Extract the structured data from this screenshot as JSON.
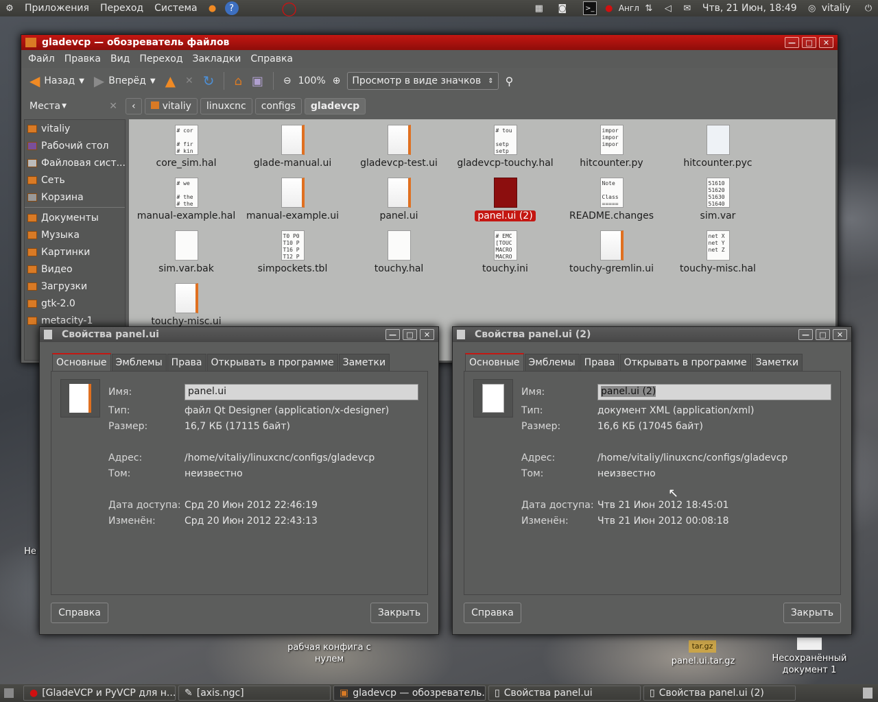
{
  "top_panel": {
    "menus": [
      "Приложения",
      "Переход",
      "Система"
    ],
    "keyboard_layout": "Англ",
    "clock": "Чтв, 21 Июн, 18:49",
    "user": "vitaliy"
  },
  "desktop": {
    "icons": [
      {
        "label": "рабчая конфига с нулем"
      },
      {
        "label": "panel.ui.tar.gz",
        "badge": "tar.gz"
      },
      {
        "label": "Несохранённый документ 1"
      },
      {
        "label": "Не"
      }
    ]
  },
  "file_browser": {
    "title": "gladevcp — обозреватель файлов",
    "menu": [
      "Файл",
      "Правка",
      "Вид",
      "Переход",
      "Закладки",
      "Справка"
    ],
    "toolbar": {
      "back": "Назад",
      "forward": "Вперёд",
      "zoom": "100%",
      "view_mode": "Просмотр в виде значков"
    },
    "places_label": "Места",
    "breadcrumbs": [
      "vitaliy",
      "linuxcnc",
      "configs",
      "gladevcp"
    ],
    "sidebar": [
      "vitaliy",
      "Рабочий стол",
      "Файловая сист...",
      "Сеть",
      "Корзина",
      "Документы",
      "Музыка",
      "Картинки",
      "Видео",
      "Загрузки",
      "gtk-2.0",
      "metacity-1"
    ],
    "files": [
      {
        "name": "core_sim.hal",
        "kind": "text",
        "preview": "# cor\n\n# fir\n# kin"
      },
      {
        "name": "glade-manual.ui",
        "kind": "ui",
        "preview": ""
      },
      {
        "name": "gladevcp-test.ui",
        "kind": "ui",
        "preview": ""
      },
      {
        "name": "gladevcp-touchy.hal",
        "kind": "text",
        "preview": "# tou\n\nsetp\nsetp"
      },
      {
        "name": "hitcounter.py",
        "kind": "text",
        "preview": "impor\nimpor\nimpor"
      },
      {
        "name": "hitcounter.pyc",
        "kind": "py",
        "preview": ""
      },
      {
        "name": "manual-example.hal",
        "kind": "text",
        "preview": "# we\n\n# the\n# the"
      },
      {
        "name": "manual-example.ui",
        "kind": "ui",
        "preview": ""
      },
      {
        "name": "panel.ui",
        "kind": "ui",
        "preview": ""
      },
      {
        "name": "panel.ui (2)",
        "kind": "selected",
        "preview": ""
      },
      {
        "name": "README.changes",
        "kind": "text",
        "preview": "Note\n\nClass\n====="
      },
      {
        "name": "sim.var",
        "kind": "text",
        "preview": "51610\n51620\n51630\n51640"
      },
      {
        "name": "sim.var.bak",
        "kind": "blank",
        "preview": ""
      },
      {
        "name": "simpockets.tbl",
        "kind": "text",
        "preview": "T0 P0\nT10 P\nT16 P\nT12 P"
      },
      {
        "name": "touchy.hal",
        "kind": "text",
        "preview": ""
      },
      {
        "name": "touchy.ini",
        "kind": "text",
        "preview": "# EMC\n[TOUC\nMACRO\nMACRO"
      },
      {
        "name": "touchy-gremlin.ui",
        "kind": "ui",
        "preview": ""
      },
      {
        "name": "touchy-misc.hal",
        "kind": "text",
        "preview": "net X\nnet Y\nnet Z"
      },
      {
        "name": "touchy-misc.ui",
        "kind": "ui",
        "preview": ""
      }
    ]
  },
  "dialog_left": {
    "title": "Свойства panel.ui",
    "tabs": [
      "Основные",
      "Эмблемы",
      "Права",
      "Открывать в программе",
      "Заметки"
    ],
    "labels": {
      "name": "Имя:",
      "type": "Тип:",
      "size": "Размер:",
      "location": "Адрес:",
      "volume": "Том:",
      "accessed": "Дата доступа:",
      "modified": "Изменён:"
    },
    "values": {
      "name": "panel.ui",
      "type": "файл Qt Designer (application/x-designer)",
      "size": "16,7 КБ (17115 байт)",
      "location": "/home/vitaliy/linuxcnc/configs/gladevcp",
      "volume": "неизвестно",
      "accessed": "Срд 20 Июн 2012 22:46:19",
      "modified": "Срд 20 Июн 2012 22:43:13"
    },
    "help": "Справка",
    "close": "Закрыть"
  },
  "dialog_right": {
    "title": "Свойства panel.ui (2)",
    "tabs": [
      "Основные",
      "Эмблемы",
      "Права",
      "Открывать в программе",
      "Заметки"
    ],
    "labels": {
      "name": "Имя:",
      "type": "Тип:",
      "size": "Размер:",
      "location": "Адрес:",
      "volume": "Том:",
      "accessed": "Дата доступа:",
      "modified": "Изменён:"
    },
    "values": {
      "name": "panel.ui (2)",
      "type": "документ XML (application/xml)",
      "size": "16,6 КБ (17045 байт)",
      "location": "/home/vitaliy/linuxcnc/configs/gladevcp",
      "volume": "неизвестно",
      "accessed": "Чтв 21 Июн 2012 18:45:01",
      "modified": "Чтв 21 Июн 2012 00:08:18"
    },
    "help": "Справка",
    "close": "Закрыть"
  },
  "taskbar": {
    "tasks": [
      "[GladeVCP и PyVCP для н...",
      "[axis.ngc]",
      "gladevcp — обозреватель...",
      "Свойства panel.ui",
      "Свойства panel.ui (2)"
    ]
  }
}
